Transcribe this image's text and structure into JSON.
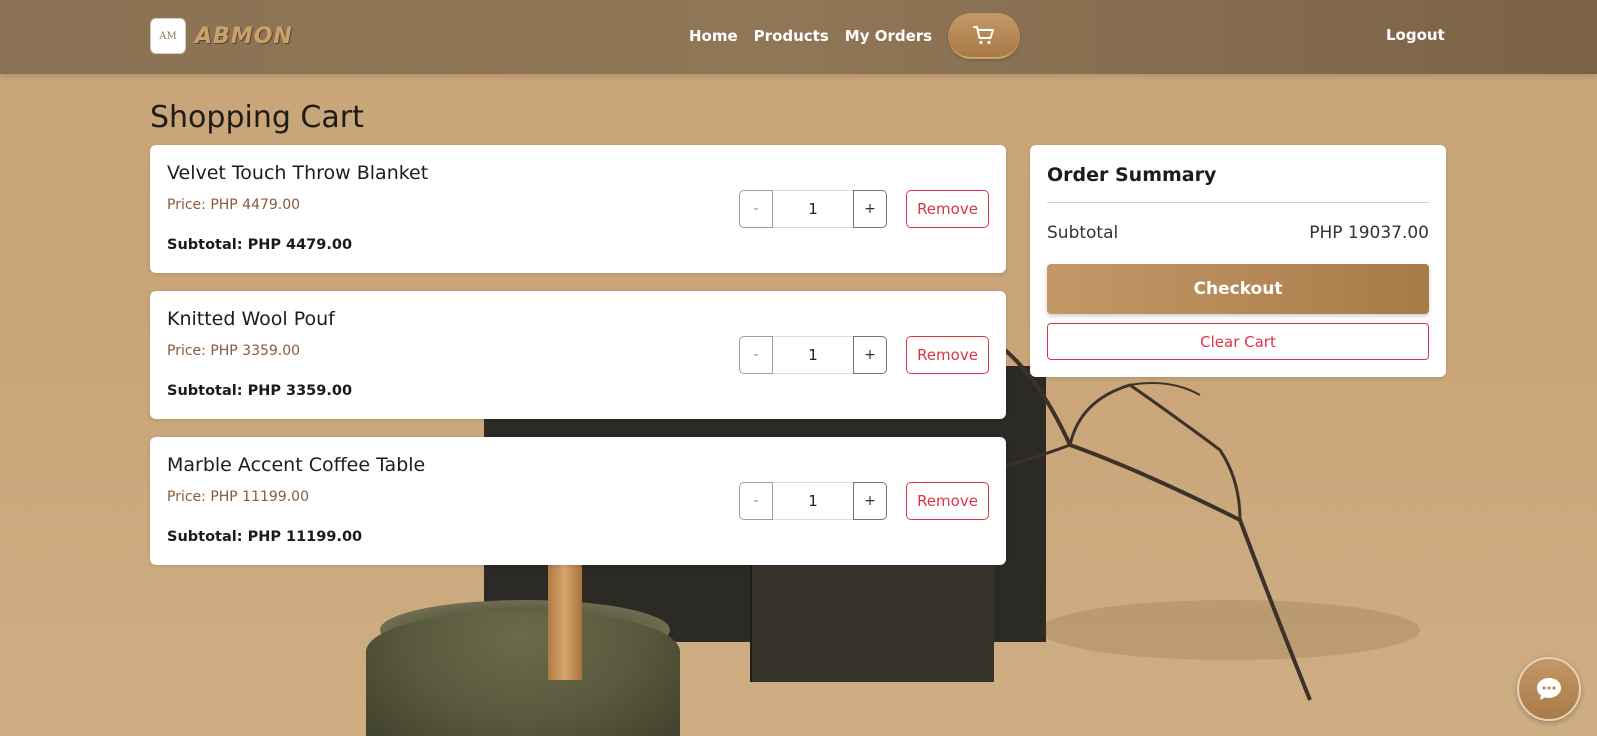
{
  "brand": {
    "logo_text": "AM",
    "name": "ABMON"
  },
  "nav": {
    "links": [
      {
        "label": "Home"
      },
      {
        "label": "Products"
      },
      {
        "label": "My Orders"
      }
    ],
    "cart_icon": "cart-icon",
    "logout_label": "Logout"
  },
  "page": {
    "title": "Shopping Cart"
  },
  "cart": {
    "items": [
      {
        "name": "Velvet Touch Throw Blanket",
        "price": "Price: PHP 4479.00",
        "quantity": "1",
        "subtotal": "Subtotal: PHP 4479.00",
        "minus_label": "-",
        "plus_label": "+",
        "remove_label": "Remove"
      },
      {
        "name": "Knitted Wool Pouf",
        "price": "Price: PHP 3359.00",
        "quantity": "1",
        "subtotal": "Subtotal: PHP 3359.00",
        "minus_label": "-",
        "plus_label": "+",
        "remove_label": "Remove"
      },
      {
        "name": "Marble Accent Coffee Table",
        "price": "Price: PHP 11199.00",
        "quantity": "1",
        "subtotal": "Subtotal: PHP 11199.00",
        "minus_label": "-",
        "plus_label": "+",
        "remove_label": "Remove"
      }
    ]
  },
  "summary": {
    "title": "Order Summary",
    "subtotal_label": "Subtotal",
    "subtotal_value": "PHP 19037.00",
    "checkout_label": "Checkout",
    "clear_label": "Clear Cart"
  },
  "chat": {
    "icon": "chat-icon"
  },
  "colors": {
    "accent": "#b88a58",
    "danger": "#dc3545",
    "navbar": "#8b7254"
  }
}
